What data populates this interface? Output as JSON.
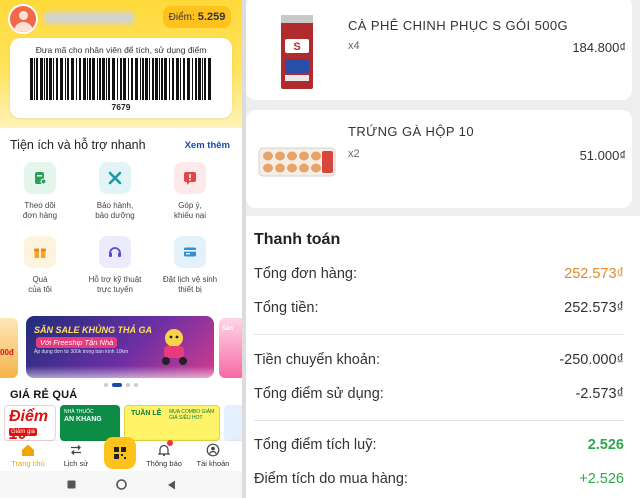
{
  "left_app": {
    "points_label": "Điểm:",
    "points_value": "5.259",
    "barcode_hint": "Đưa mã cho nhân viên để tích, sử dụng điểm",
    "barcode_number": "7679",
    "utilities_title": "Tiện ích và hỗ trợ nhanh",
    "see_more": "Xem thêm",
    "utilities": [
      {
        "label": "Theo dõi\nđơn hàng",
        "icon": "order-tracking-icon"
      },
      {
        "label": "Bảo hành,\nbảo dưỡng",
        "icon": "wrench-icon"
      },
      {
        "label": "Góp ý,\nkhiếu nại",
        "icon": "feedback-icon"
      },
      {
        "label": "Quà\ncủa tôi",
        "icon": "gift-icon"
      },
      {
        "label": "Hỗ trợ kỹ thuật\ntrực tuyến",
        "icon": "headset-icon"
      },
      {
        "label": "Đặt lịch vệ sinh\nthiết bị",
        "icon": "calendar-card-icon"
      }
    ],
    "banner": {
      "headline": "SĂN SALE KHỦNG THẢ GA",
      "sub": "Với Freeship Tận Nhà",
      "fine": "Áp dụng đơn từ 300k trong bán kính 10km"
    },
    "cheap_title": "GIÁ RẺ QUÁ",
    "promos": {
      "p1_big": "Điểm 10",
      "p1_small": "Giảm giá",
      "p2_top": "NHÀ THUỐC",
      "p2_main": "AN KHANG",
      "p3_main": "TUẦN LỄ",
      "p3_sub": "MUA COMBO GIẢM GIÁ SIÊU HOT"
    },
    "nav": [
      {
        "label": "Trang chủ",
        "icon": "home-icon"
      },
      {
        "label": "Lịch sử",
        "icon": "swap-icon"
      },
      {
        "label": "",
        "icon": "scan-icon"
      },
      {
        "label": "Thông báo",
        "icon": "bell-icon"
      },
      {
        "label": "Tài khoản",
        "icon": "account-icon"
      }
    ],
    "colors": {
      "accent": "#ffc21c",
      "link": "#1f4aa8"
    }
  },
  "right_app": {
    "items": [
      {
        "name": "CÀ PHÊ CHINH PHỤC S GÓI 500G",
        "qty": "x4",
        "price": "184.800₫"
      },
      {
        "name": "TRỨNG GÀ HỘP 10",
        "qty": "x2",
        "price": "51.000₫"
      }
    ],
    "payment": {
      "title": "Thanh toán",
      "rows": [
        {
          "label": "Tổng đơn hàng:",
          "value": "252.573₫"
        },
        {
          "label": "Tổng tiền:",
          "value": "252.573₫"
        },
        {
          "label": "Tiền chuyển khoản:",
          "value": "-250.000₫"
        },
        {
          "label": "Tổng điểm sử dụng:",
          "value": "-2.573₫"
        },
        {
          "label": "Tổng điểm tích luỹ:",
          "value": "2.526"
        },
        {
          "label": "Điểm tích do mua hàng:",
          "value": "+2.526"
        }
      ]
    },
    "colors": {
      "orange": "#e08a2e",
      "green": "#2aa84a"
    }
  }
}
